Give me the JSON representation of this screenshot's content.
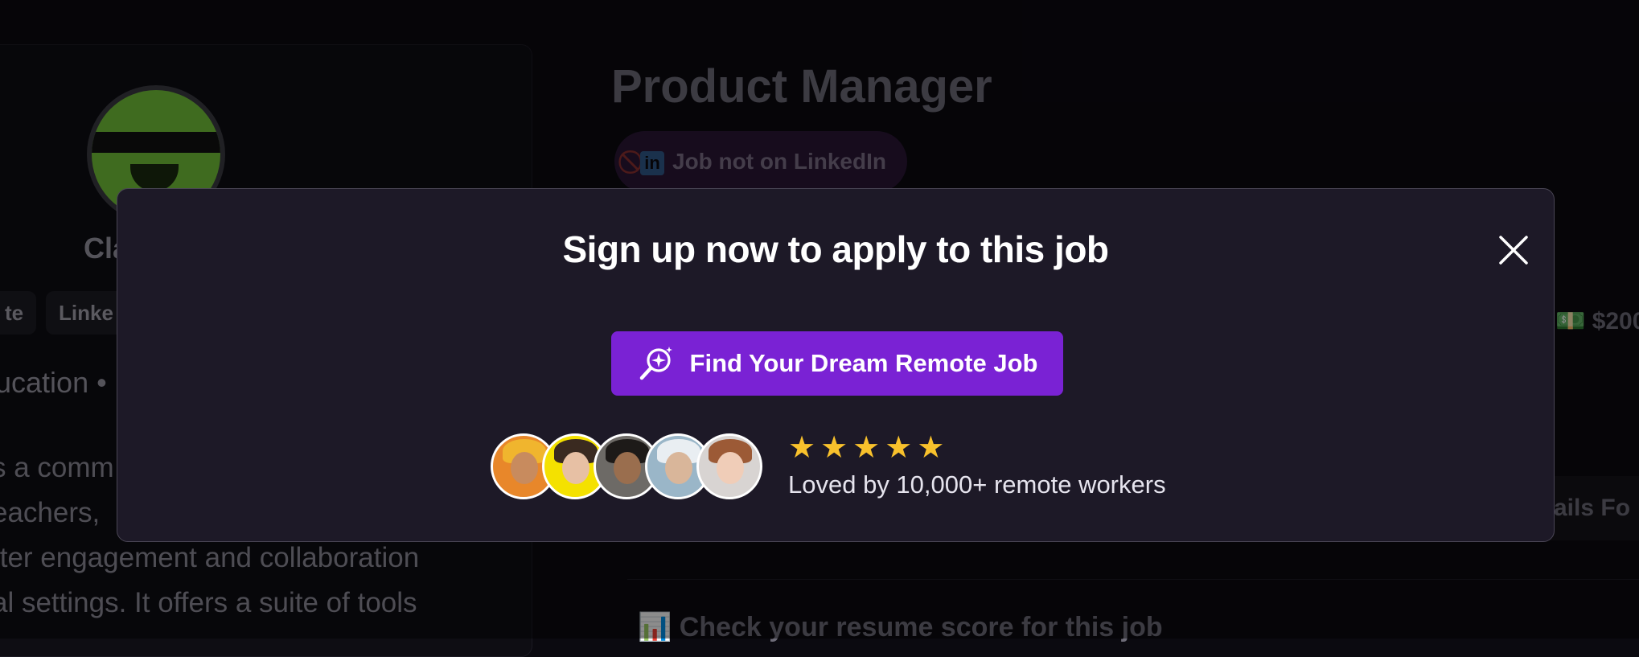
{
  "background": {
    "company_name": "Cla",
    "chips": [
      "te",
      "Linke"
    ],
    "industry": "ucation •",
    "description_lines": [
      "s a comm",
      "eachers,",
      "tter engagement and collaboration",
      "al settings. It offers a suite of tools"
    ],
    "job_title": "Product Manager",
    "linkedin_badge": "Job not on LinkedIn",
    "linkedin_icon": "in",
    "salary": "💵 $200",
    "details_button": "ails Fo",
    "resume_check": "📊 Check your resume score for this job"
  },
  "modal": {
    "title": "Sign up now to apply to this job",
    "cta_label": "Find Your Dream Remote Job",
    "cta_color": "#7a22d4",
    "stars": [
      "★",
      "★",
      "★",
      "★",
      "★"
    ],
    "star_color": "#f8c12c",
    "social_proof": "Loved by 10,000+ remote workers"
  }
}
